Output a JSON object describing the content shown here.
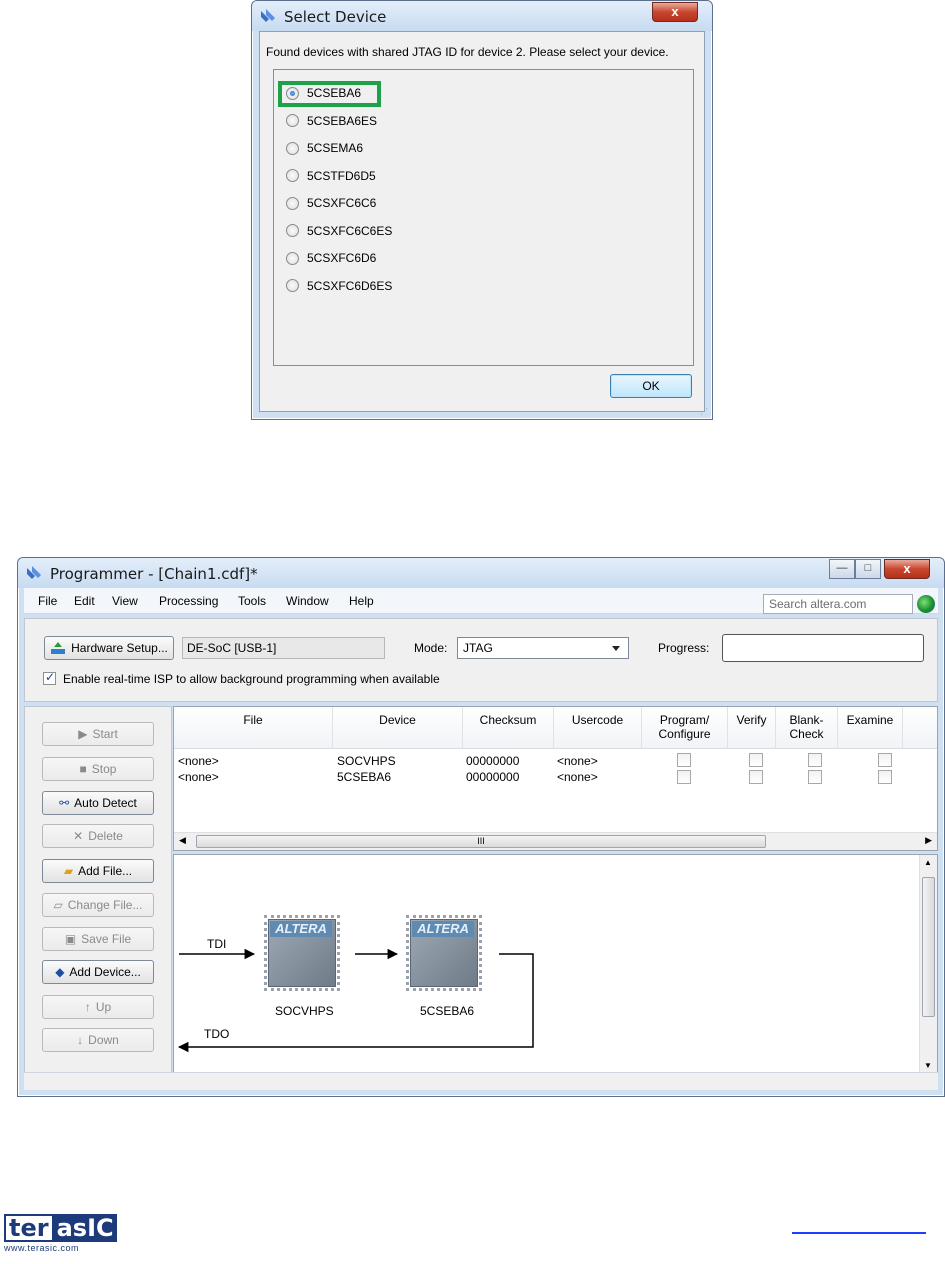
{
  "dialog": {
    "title": "Select Device",
    "close_glyph": "x",
    "message": "Found devices with shared JTAG ID for device 2. Please select your device.",
    "devices": [
      {
        "label": "5CSEBA6",
        "selected": true
      },
      {
        "label": "5CSEBA6ES",
        "selected": false
      },
      {
        "label": "5CSEMA6",
        "selected": false
      },
      {
        "label": "5CSTFD6D5",
        "selected": false
      },
      {
        "label": "5CSXFC6C6",
        "selected": false
      },
      {
        "label": "5CSXFC6C6ES",
        "selected": false
      },
      {
        "label": "5CSXFC6D6",
        "selected": false
      },
      {
        "label": "5CSXFC6D6ES",
        "selected": false
      }
    ],
    "ok_label": "OK",
    "highlight_color": "#1fa14a"
  },
  "programmer": {
    "title": "Programmer - [Chain1.cdf]*",
    "menu": [
      "File",
      "Edit",
      "View",
      "Processing",
      "Tools",
      "Window",
      "Help"
    ],
    "search_placeholder": "Search altera.com",
    "hardware_setup_label": "Hardware Setup...",
    "hardware_value": "DE-SoC [USB-1]",
    "mode_label": "Mode:",
    "mode_value": "JTAG",
    "progress_label": "Progress:",
    "isp_checkbox_label": "Enable real-time ISP to allow background programming when available",
    "isp_checked": true,
    "sidebar": {
      "start": "Start",
      "stop": "Stop",
      "auto_detect": "Auto Detect",
      "delete": "Delete",
      "add_file": "Add File...",
      "change_file": "Change File...",
      "save_file": "Save File",
      "add_device": "Add Device...",
      "up": "Up",
      "down": "Down"
    },
    "table": {
      "columns": [
        "File",
        "Device",
        "Checksum",
        "Usercode",
        "Program/\nConfigure",
        "Verify",
        "Blank-\nCheck",
        "Examine"
      ],
      "rows": [
        {
          "file": "<none>",
          "device": "SOCVHPS",
          "checksum": "00000000",
          "usercode": "<none>"
        },
        {
          "file": "<none>",
          "device": "5CSEBA6",
          "checksum": "00000000",
          "usercode": "<none>"
        }
      ],
      "hscroll_glyph": "III"
    },
    "chain": {
      "tdi": "TDI",
      "tdo": "TDO",
      "chips": [
        {
          "logo": "ALTERA",
          "name": "SOCVHPS"
        },
        {
          "logo": "ALTERA",
          "name": "5CSEBA6"
        }
      ]
    },
    "window_buttons": {
      "minimize": "—",
      "maximize": "□",
      "close": "x"
    }
  },
  "footer": {
    "logo_ter": "ter",
    "logo_asic": "asIC",
    "logo_url": "www.terasic.com"
  }
}
